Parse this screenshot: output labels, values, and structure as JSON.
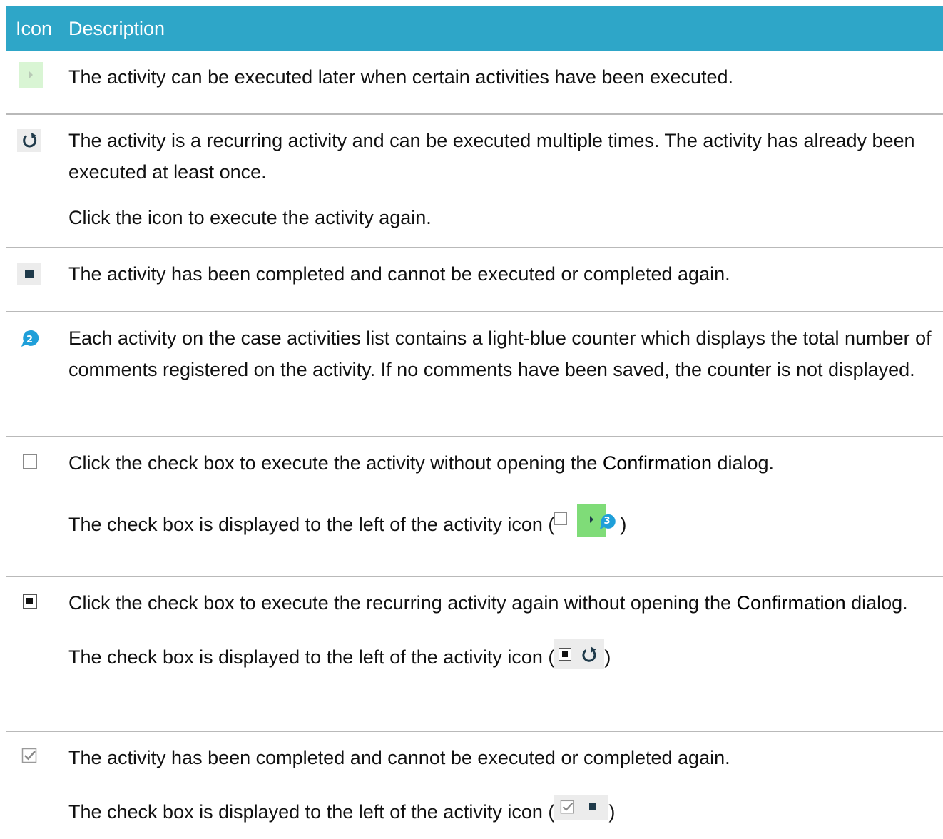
{
  "header": {
    "icon_col": "Icon",
    "desc_col": "Description"
  },
  "rows": [
    {
      "icon": "later-arrow-icon",
      "paragraphs": [
        "The activity can be executed later when certain activities have been executed."
      ]
    },
    {
      "icon": "recurring-icon",
      "paragraphs": [
        "The activity is a recurring activity and can be executed multiple times. The activity has already been executed at least once.",
        "Click the icon to execute the activity again."
      ]
    },
    {
      "icon": "completed-square-icon",
      "paragraphs": [
        "The activity has been completed and cannot be executed or completed again."
      ]
    },
    {
      "icon": "comment-counter-icon",
      "counter": "2",
      "paragraphs": [
        "Each activity on the case activities list contains a light-blue counter which displays the total number of comments registered on the activity. If no comments have been saved, the counter is not displayed."
      ]
    },
    {
      "icon": "checkbox-empty-icon",
      "p1_pre": "Click the check box to execute the activity without opening the ",
      "p1_bold": "Confirmation",
      "p1_post": " dialog.",
      "p2_pre": "The check box is displayed to the left of the activity icon (",
      "p2_post": ")",
      "inline_counter": "3"
    },
    {
      "icon": "checkbox-filled-icon",
      "p1_pre": "Click the check box to execute the recurring activity again without opening the ",
      "p1_bold": "Con­firmation",
      "p1_post": " dialog.",
      "p2_pre": "The check box is displayed to the left of the activity icon (",
      "p2_post": ")"
    },
    {
      "icon": "checkbox-checked-icon",
      "p1": "The activity has been completed and cannot be executed or completed again.",
      "p2_pre": "The check box is displayed to the left of the activity icon (",
      "p2_post": ")"
    }
  ],
  "colors": {
    "header_bg": "#2ea6c8",
    "later_bg": "#d9f5d4",
    "later_bg_strong": "#7fdc78",
    "counter": "#1f9fd9",
    "dark_square": "#1f3a4a"
  }
}
